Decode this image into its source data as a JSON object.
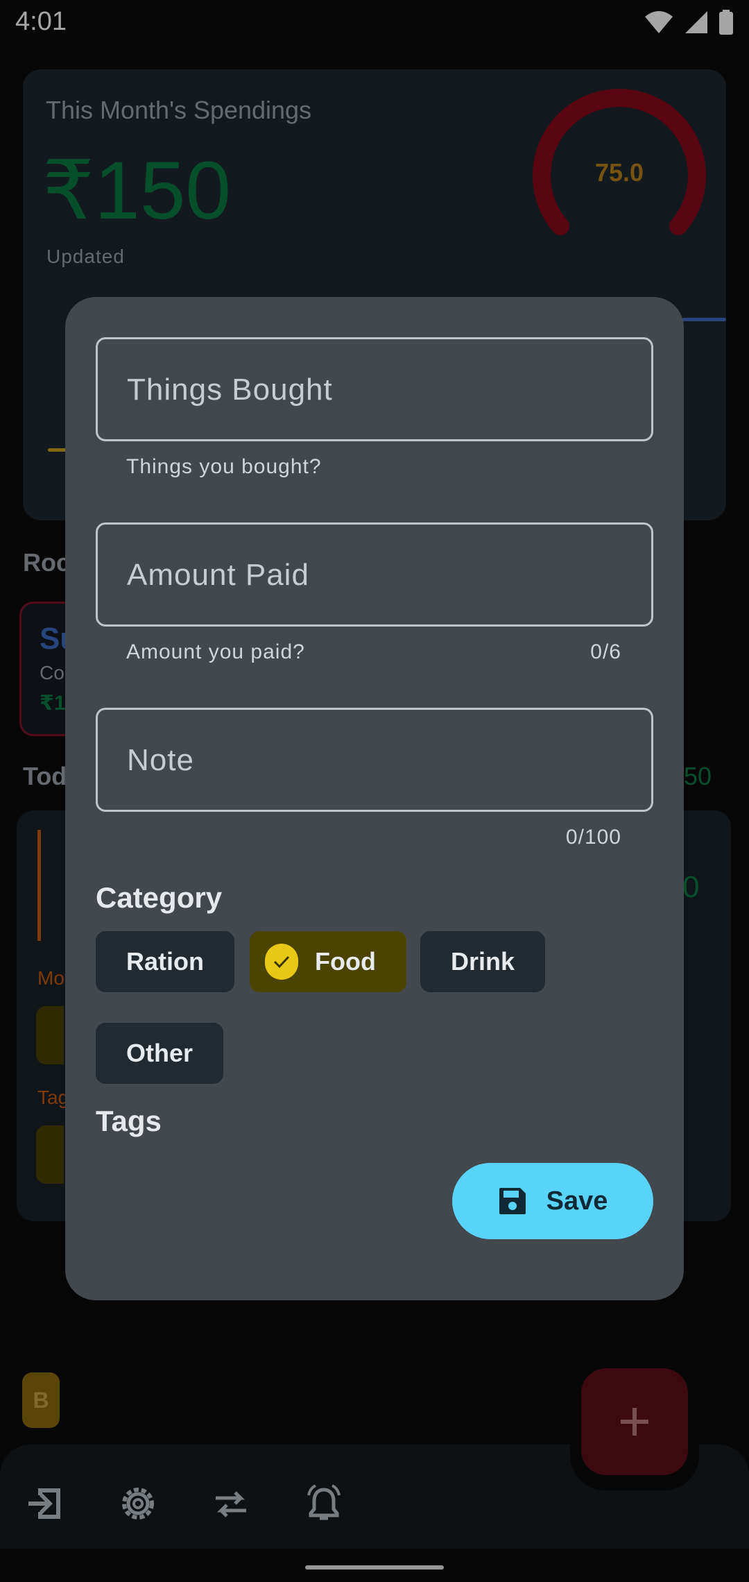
{
  "status_bar": {
    "time": "4:01"
  },
  "summary": {
    "title": "This Month's Spendings",
    "amount": "₹150",
    "updated_label": "Updated",
    "gauge_value": "75.0"
  },
  "background": {
    "recent_label": "Roc",
    "recent_card": {
      "t1": "Su",
      "t2": "Co",
      "t3": "₹1"
    },
    "today_label": "Tod",
    "today_total": "50",
    "today_amount": "0",
    "mo_label": "Mo",
    "tag_label": "Tag",
    "avatar_letter": "B"
  },
  "dialog": {
    "things_field": {
      "placeholder": "Things Bought",
      "helper": "Things you bought?"
    },
    "amount_field": {
      "placeholder": "Amount Paid",
      "helper": "Amount you paid?",
      "counter": "0/6"
    },
    "note_field": {
      "placeholder": "Note",
      "counter": "0/100"
    },
    "category_title": "Category",
    "categories": [
      {
        "label": "Ration",
        "selected": false
      },
      {
        "label": "Food",
        "selected": true
      },
      {
        "label": "Drink",
        "selected": false
      },
      {
        "label": "Other",
        "selected": false
      }
    ],
    "tags_title": "Tags",
    "save_label": "Save"
  },
  "bottom_nav": {
    "icons": [
      "exit-icon",
      "settings-icon",
      "swap-icon",
      "alarm-icon"
    ],
    "fab_icon": "plus-icon"
  },
  "colors": {
    "accent_save": "#5ad3f8",
    "selected_chip": "#4b4300",
    "check": "#e7c815",
    "amount_green": "#0c7a43",
    "gauge_red": "#8b0a1c",
    "fab": "#5e0f1a"
  }
}
